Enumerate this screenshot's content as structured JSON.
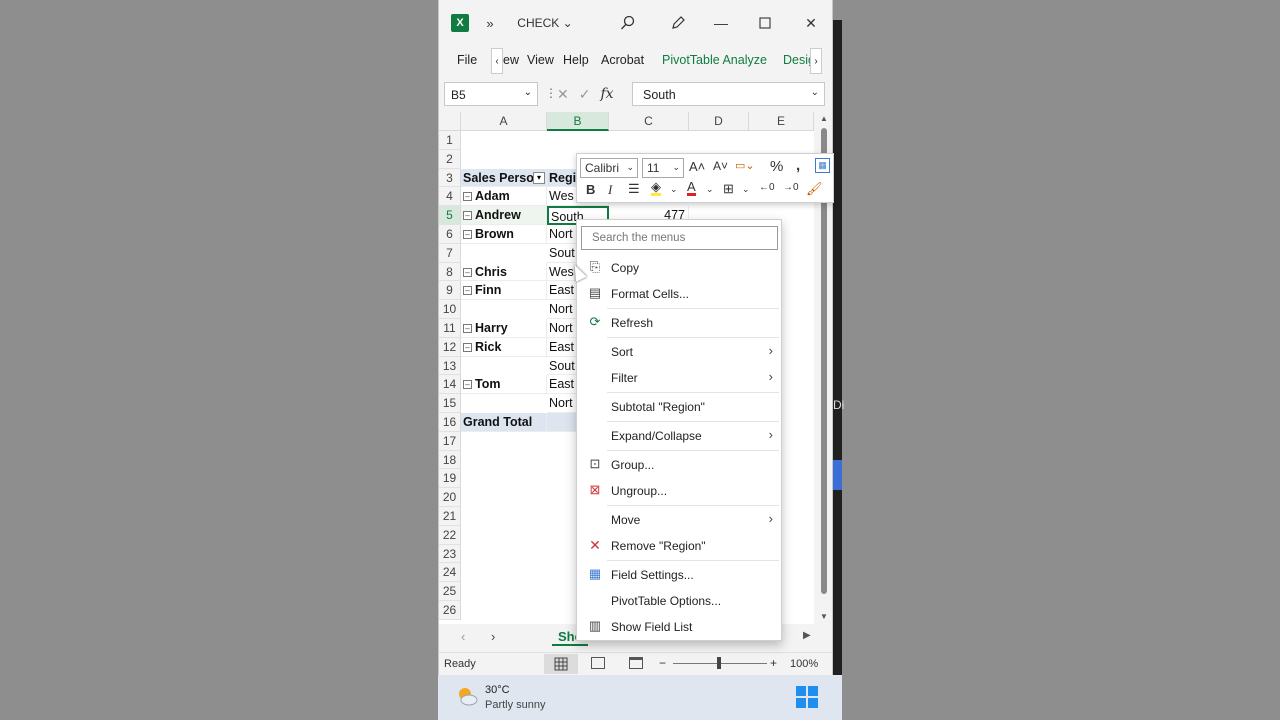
{
  "title": {
    "app_icon": "excel-logo",
    "doc_name": "CHECK"
  },
  "menubar": {
    "items": [
      "File",
      "ew",
      "View",
      "Help",
      "Acrobat",
      "PivotTable Analyze",
      "Desig"
    ]
  },
  "formula": {
    "namebox": "B5",
    "value": "South",
    "fx": "fx"
  },
  "columns": [
    "A",
    "B",
    "C",
    "D",
    "E"
  ],
  "rows": [
    "1",
    "2",
    "3",
    "4",
    "5",
    "6",
    "7",
    "8",
    "9",
    "10",
    "11",
    "12",
    "13",
    "14",
    "15",
    "16",
    "17",
    "18",
    "19",
    "20",
    "21",
    "22",
    "23",
    "24",
    "25",
    "26"
  ],
  "cells": {
    "a3": "Sales Person",
    "b3": "Regi",
    "a4": "Adam",
    "b4": "Wes",
    "a5": "Andrew",
    "b5": "South",
    "c5": "477",
    "a6": "Brown",
    "b6": "Nort",
    "b7": "Sout",
    "a8": "Chris",
    "b8": "Wes",
    "a9": "Finn",
    "b9": "East",
    "b10": "Nort",
    "a11": "Harry",
    "b11": "Nort",
    "a12": "Rick",
    "b12": "East",
    "b13": "Sout",
    "a14": "Tom",
    "b14": "East",
    "b15": "Nort",
    "a16": "Grand Total"
  },
  "sheet": {
    "tab": "She"
  },
  "status": {
    "ready": "Ready",
    "zoom": "100%"
  },
  "mini_toolbar": {
    "font": "Calibri",
    "size": "11"
  },
  "context_menu": {
    "search_placeholder": "Search the menus",
    "items": {
      "copy": "Copy",
      "format_cells": "Format Cells...",
      "refresh": "Refresh",
      "sort": "Sort",
      "filter": "Filter",
      "subtotal": "Subtotal \"Region\"",
      "expand": "Expand/Collapse",
      "group": "Group...",
      "ungroup": "Ungroup...",
      "move": "Move",
      "remove": "Remove \"Region\"",
      "field_settings": "Field Settings...",
      "pivot_options": "PivotTable Options...",
      "field_list": "Show Field List"
    }
  },
  "taskbar": {
    "temp": "30°C",
    "weather": "Partly sunny"
  },
  "side_fragment": "Di",
  "colors": {
    "excel_green": "#107c41",
    "pivot_header": "#dde5f0",
    "remove_red": "#d13438"
  }
}
